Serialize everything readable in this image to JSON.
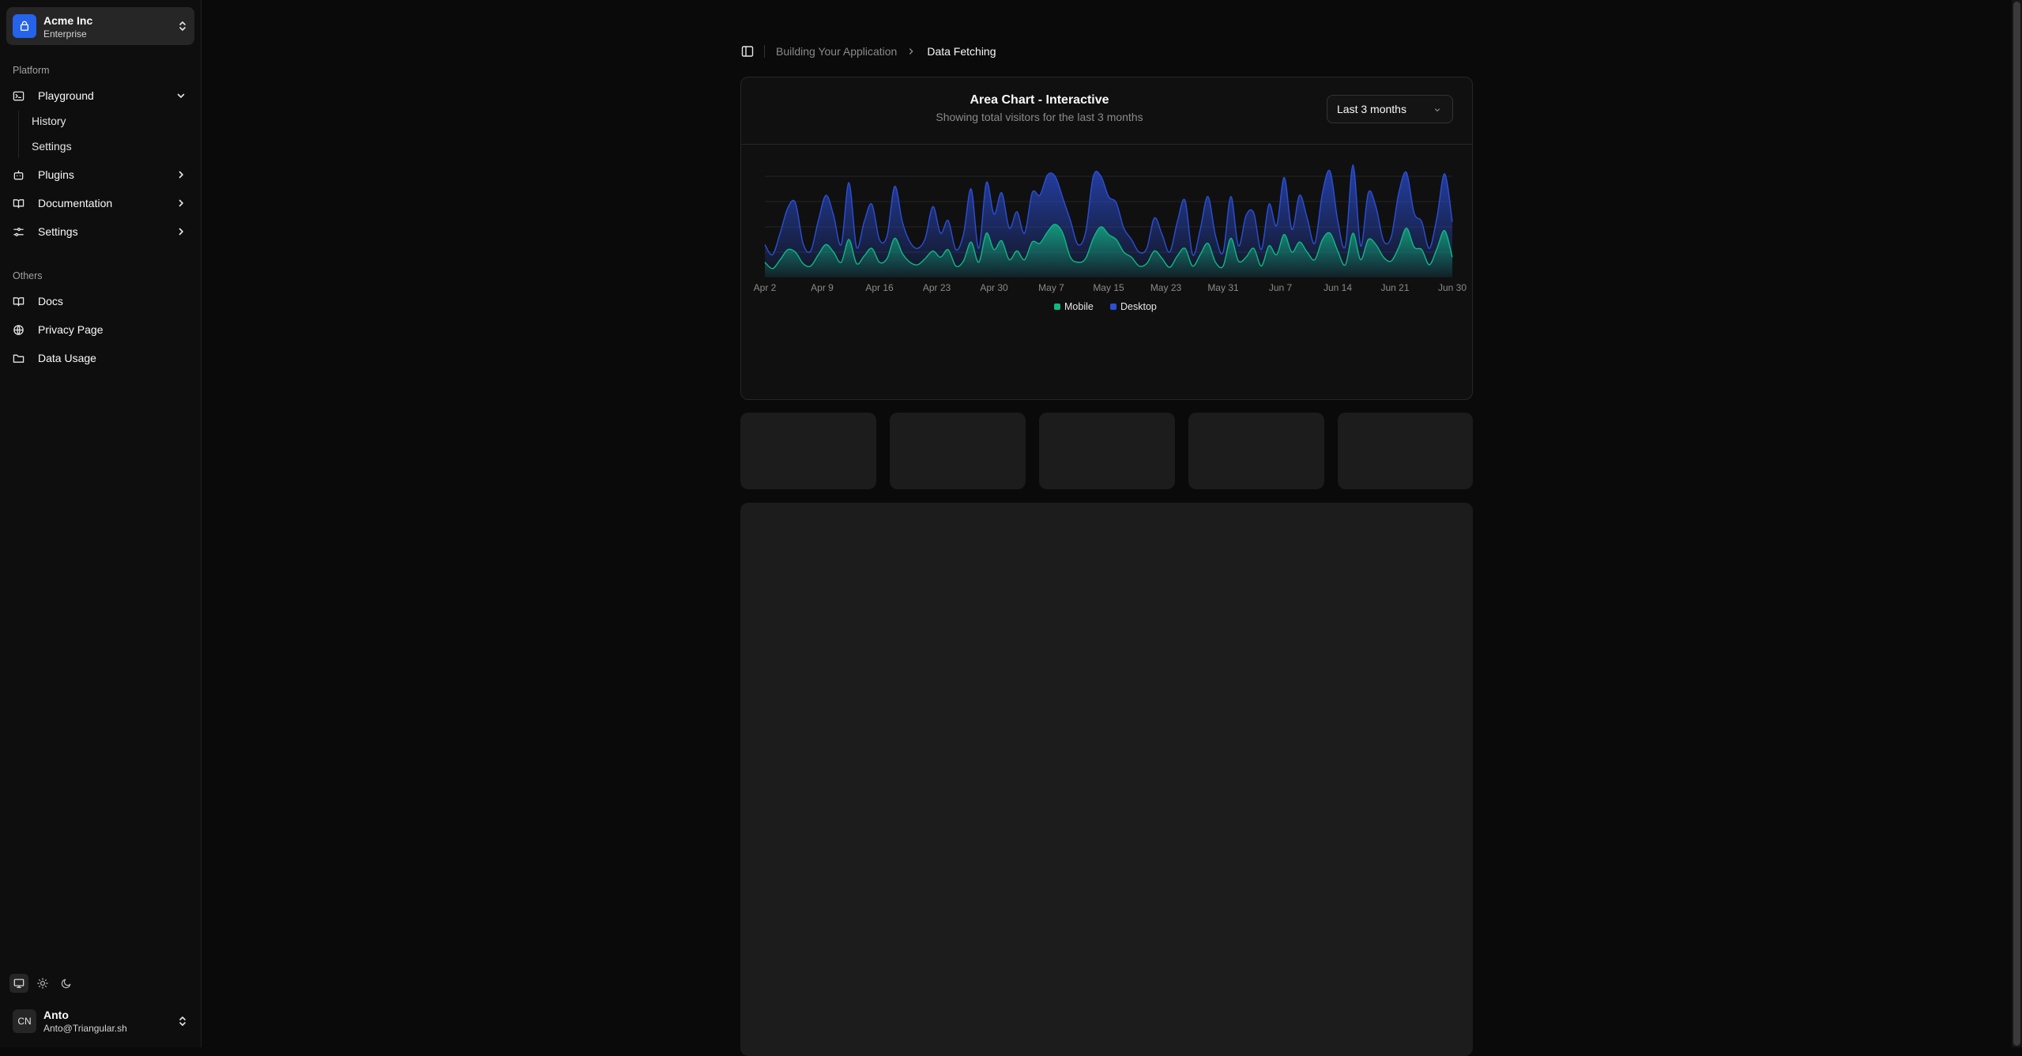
{
  "sidebar": {
    "team": {
      "name": "Acme Inc",
      "plan": "Enterprise"
    },
    "groups": {
      "platform_label": "Platform",
      "others_label": "Others"
    },
    "platform_items": [
      {
        "label": "Playground",
        "icon": "terminal-icon",
        "state": "expanded"
      },
      {
        "label": "Plugins",
        "icon": "bot-icon",
        "state": "collapsed"
      },
      {
        "label": "Documentation",
        "icon": "book-icon",
        "state": "collapsed"
      },
      {
        "label": "Settings",
        "icon": "sliders-icon",
        "state": "collapsed"
      }
    ],
    "playground_sub_items": [
      {
        "label": "History"
      },
      {
        "label": "Settings"
      }
    ],
    "others_items": [
      {
        "label": "Docs",
        "icon": "book-open-icon"
      },
      {
        "label": "Privacy Page",
        "icon": "globe-icon"
      },
      {
        "label": "Data Usage",
        "icon": "folder-icon"
      }
    ],
    "theme_options": [
      "monitor-icon",
      "sun-icon",
      "moon-icon"
    ],
    "theme_selected": "monitor-icon",
    "user": {
      "initials": "CN",
      "name": "Anto",
      "email": "Anto@Triangular.sh"
    }
  },
  "breadcrumb": {
    "parent": "Building Your Application",
    "current": "Data Fetching"
  },
  "card": {
    "title": "Area Chart - Interactive",
    "description": "Showing total visitors for the last 3 months",
    "range_select": {
      "value": "Last 3 months"
    }
  },
  "colors": {
    "mobile": "#10b981",
    "desktop": "#2b4fd8",
    "background": "#0a0a0a",
    "card": "#101010"
  },
  "chart_data": {
    "type": "area",
    "stacked": true,
    "title": "Area Chart - Interactive",
    "x_start": "Apr 2",
    "x_end": "Jun 30",
    "x_tick_labels": [
      "Apr 2",
      "Apr 9",
      "Apr 16",
      "Apr 23",
      "Apr 30",
      "May 7",
      "May 15",
      "May 23",
      "May 31",
      "Jun 7",
      "Jun 14",
      "Jun 21",
      "Jun 30"
    ],
    "ylim": [
      0,
      1000
    ],
    "grid": true,
    "legend": "bottom-center",
    "series": [
      {
        "name": "Mobile",
        "color": "#10b981",
        "values": [
          120,
          70,
          140,
          220,
          200,
          110,
          90,
          180,
          260,
          200,
          120,
          300,
          110,
          170,
          230,
          120,
          150,
          310,
          190,
          120,
          100,
          150,
          210,
          160,
          220,
          90,
          130,
          280,
          120,
          350,
          220,
          290,
          140,
          210,
          140,
          280,
          270,
          360,
          420,
          350,
          160,
          120,
          150,
          310,
          400,
          340,
          300,
          200,
          160,
          90,
          110,
          210,
          150,
          80,
          170,
          230,
          90,
          180,
          270,
          120,
          90,
          310,
          130,
          160,
          230,
          90,
          250,
          180,
          340,
          200,
          280,
          200,
          140,
          300,
          350,
          210,
          100,
          350,
          140,
          300,
          260,
          160,
          130,
          240,
          390,
          240,
          220,
          100,
          230,
          370,
          160
        ]
      },
      {
        "name": "Desktop",
        "color": "#2b4fd8",
        "values": [
          140,
          110,
          210,
          330,
          390,
          160,
          120,
          270,
          390,
          290,
          140,
          450,
          130,
          270,
          350,
          180,
          180,
          410,
          250,
          160,
          130,
          160,
          350,
          190,
          230,
          130,
          210,
          420,
          110,
          400,
          280,
          380,
          250,
          310,
          210,
          390,
          380,
          450,
          380,
          280,
          290,
          140,
          210,
          490,
          400,
          300,
          290,
          190,
          140,
          110,
          120,
          260,
          190,
          120,
          270,
          380,
          90,
          200,
          370,
          210,
          110,
          330,
          120,
          330,
          280,
          130,
          330,
          230,
          450,
          180,
          370,
          270,
          130,
          370,
          490,
          240,
          150,
          540,
          110,
          370,
          300,
          130,
          190,
          430,
          440,
          270,
          220,
          130,
          250,
          450,
          280
        ]
      }
    ]
  }
}
